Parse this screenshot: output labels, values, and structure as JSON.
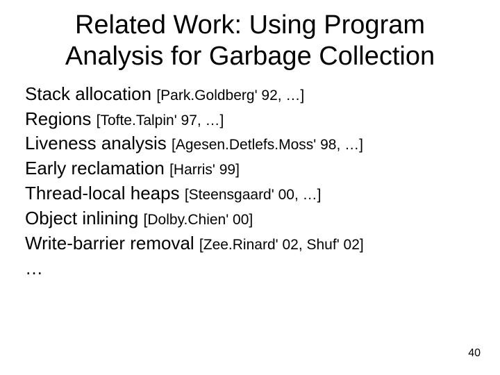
{
  "title_line1": "Related Work: Using Program",
  "title_line2": "Analysis for Garbage Collection",
  "items": [
    {
      "topic": "Stack allocation ",
      "ref": "[Park.Goldberg' 92, …]"
    },
    {
      "topic": "Regions ",
      "ref": "[Tofte.Talpin' 97, …]"
    },
    {
      "topic": "Liveness analysis ",
      "ref": "[Agesen.Detlefs.Moss' 98, …]"
    },
    {
      "topic": "Early reclamation ",
      "ref": "[Harris' 99]"
    },
    {
      "topic": "Thread-local heaps ",
      "ref": "[Steensgaard' 00, …]"
    },
    {
      "topic": "Object inlining ",
      "ref": "[Dolby.Chien' 00]"
    },
    {
      "topic": "Write-barrier removal ",
      "ref": "[Zee.Rinard' 02, Shuf' 02]"
    },
    {
      "topic": "…",
      "ref": ""
    }
  ],
  "page_number": "40"
}
